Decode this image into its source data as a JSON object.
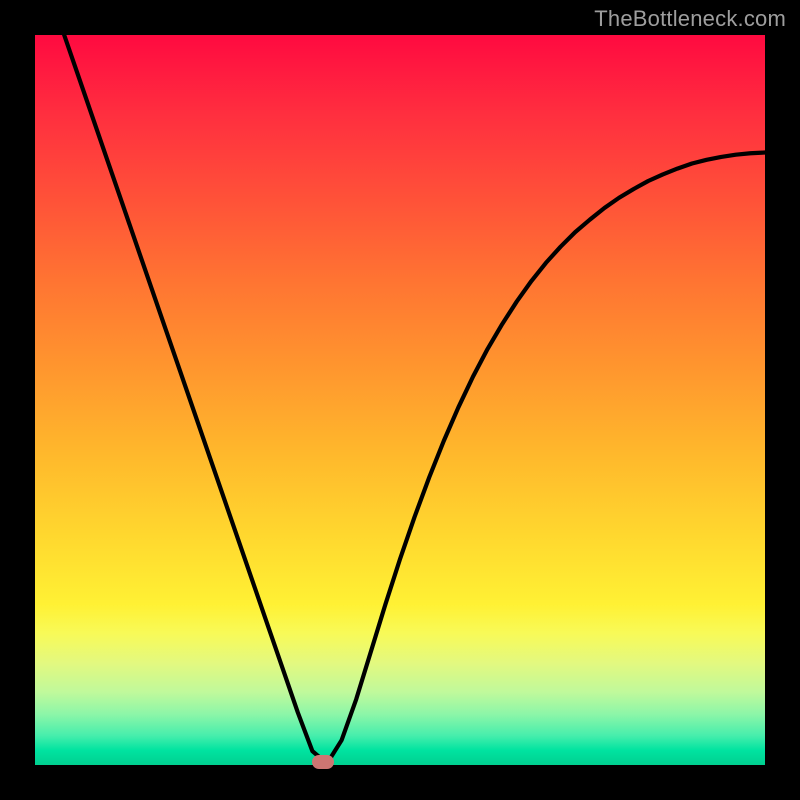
{
  "watermark": "TheBottleneck.com",
  "colors": {
    "frame": "#000000",
    "gradient_top": "#ff0a40",
    "gradient_bottom": "#00d090",
    "curve": "#000000",
    "marker": "#cd7572",
    "watermark_text": "#9e9e9e"
  },
  "chart_data": {
    "type": "line",
    "title": "",
    "xlabel": "",
    "ylabel": "",
    "xlim": [
      0,
      100
    ],
    "ylim": [
      0,
      100
    ],
    "grid": false,
    "legend": false,
    "series": [
      {
        "name": "bottleneck-curve",
        "x": [
          4,
          6,
          8,
          10,
          12,
          14,
          16,
          18,
          20,
          22,
          24,
          26,
          28,
          30,
          32,
          34,
          36,
          38,
          40,
          42,
          44,
          46,
          48,
          50,
          52,
          54,
          56,
          58,
          60,
          62,
          64,
          66,
          68,
          70,
          72,
          74,
          76,
          78,
          80,
          82,
          84,
          86,
          88,
          90,
          92,
          94,
          96,
          98,
          100
        ],
        "y": [
          100,
          94.2,
          88.4,
          82.6,
          76.8,
          71.0,
          65.2,
          59.4,
          53.6,
          47.8,
          42.0,
          36.2,
          30.4,
          24.6,
          18.8,
          13.0,
          7.2,
          1.9,
          0.2,
          3.4,
          9.0,
          15.5,
          22.0,
          28.2,
          34.0,
          39.4,
          44.4,
          49.0,
          53.2,
          57.0,
          60.4,
          63.5,
          66.3,
          68.8,
          71.0,
          73.0,
          74.7,
          76.3,
          77.7,
          78.9,
          80.0,
          80.9,
          81.7,
          82.4,
          82.9,
          83.3,
          83.6,
          83.8,
          83.9
        ]
      }
    ],
    "annotations": [
      {
        "name": "minimum-marker",
        "x": 39.5,
        "y": 0.0
      }
    ]
  }
}
